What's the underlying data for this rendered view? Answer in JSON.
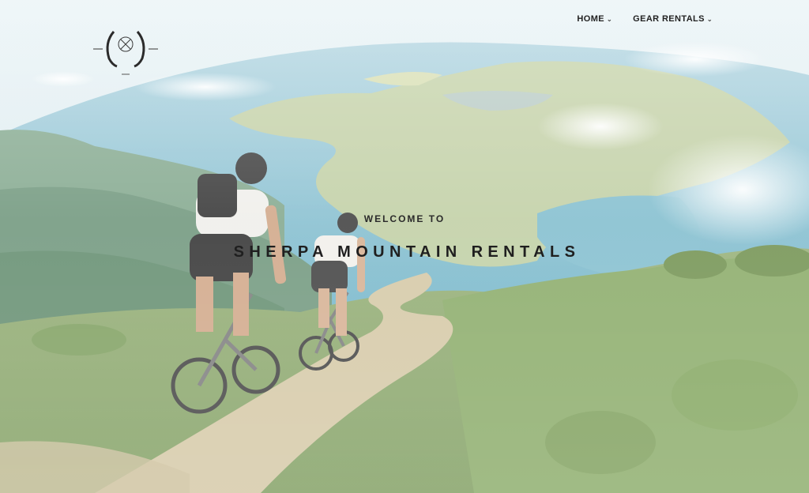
{
  "nav": {
    "items": [
      {
        "label": "HOME",
        "icon": "chevron-down-icon"
      },
      {
        "label": "GEAR RENTALS",
        "icon": "chevron-down-icon"
      }
    ]
  },
  "hero": {
    "welcome": "WELCOME TO",
    "title": "SHERPA MOUNTAIN RENTALS"
  },
  "colors": {
    "sky": "#d8ebf0",
    "ocean": "#6fb3c7",
    "land": "#b9c99a",
    "hills": "#6e9a7a",
    "grass": "#8aa86a",
    "trail": "#cdbf9a",
    "text": "#1f1f1f"
  }
}
